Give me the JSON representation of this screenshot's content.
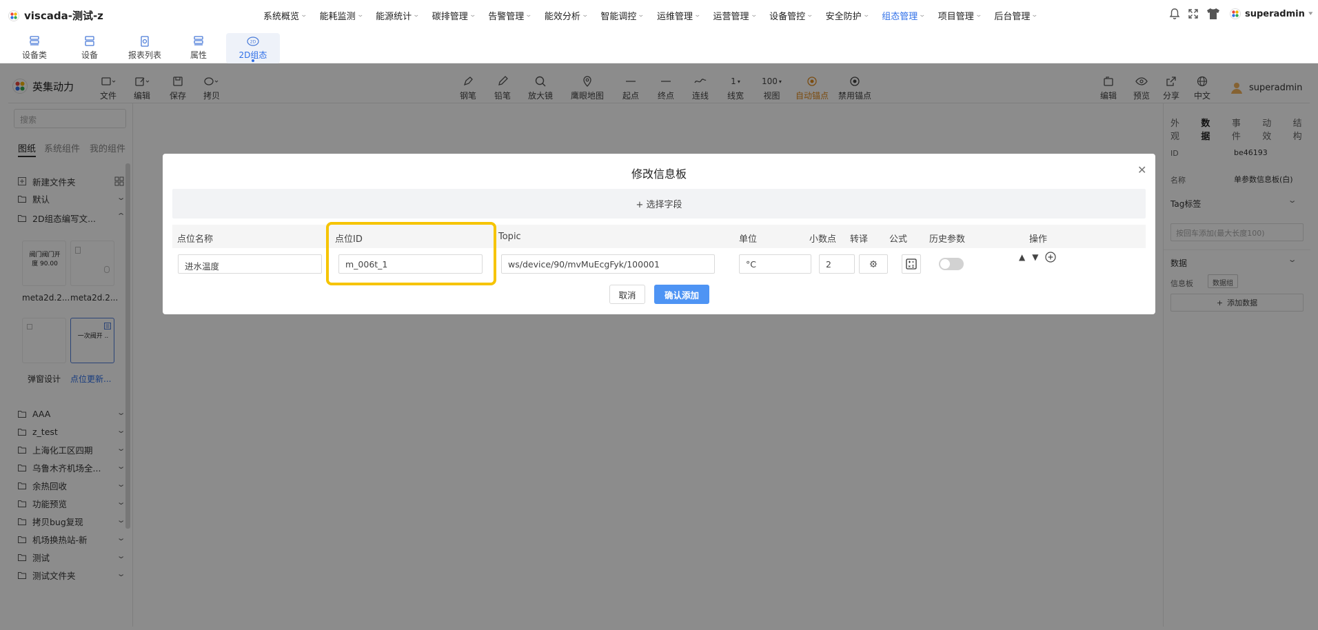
{
  "app": {
    "title": "viscada-测试-z",
    "user": "superadmin"
  },
  "mainnav": [
    {
      "label": "系统概览"
    },
    {
      "label": "能耗监测"
    },
    {
      "label": "能源统计"
    },
    {
      "label": "碳排管理"
    },
    {
      "label": "告警管理"
    },
    {
      "label": "能效分析"
    },
    {
      "label": "智能调控"
    },
    {
      "label": "运维管理"
    },
    {
      "label": "运营管理"
    },
    {
      "label": "设备管控"
    },
    {
      "label": "安全防护"
    },
    {
      "label": "组态管理",
      "active": true
    },
    {
      "label": "项目管理"
    },
    {
      "label": "后台管理"
    }
  ],
  "subtabs": [
    "设备类",
    "设备",
    "报表列表",
    "属性",
    "2D组态"
  ],
  "editor": {
    "logo": "英集动力",
    "tools_left": [
      "文件",
      "编辑",
      "保存",
      "拷贝"
    ],
    "tools_center": [
      "钢笔",
      "铅笔",
      "放大镜",
      "鹰眼地图",
      "起点",
      "终点",
      "连线",
      "线宽",
      "视图",
      "自动锚点",
      "禁用锚点"
    ],
    "line_width_value": "1",
    "view_value": "100",
    "tools_right": [
      "编辑",
      "预览",
      "分享",
      "中文"
    ],
    "user": "superadmin"
  },
  "leftpanel": {
    "search_placeholder": "搜索",
    "tabs": [
      "图纸",
      "系统组件",
      "我的组件"
    ],
    "new_folder": "新建文件夹",
    "folders_top": [
      "默认",
      "2D组态编写文..."
    ],
    "thumbs": [
      {
        "name": "meta2d.2...",
        "preview": "阀门阀门开度 90.00"
      },
      {
        "name": "meta2d.2...",
        "preview": ""
      },
      {
        "name": "弹窗设计",
        "preview": ""
      },
      {
        "name": "点位更新...",
        "preview": "一次阀开 .."
      }
    ],
    "folders_bottom": [
      "AAA",
      "z_test",
      "上海化工区四期",
      "乌鲁木齐机场全...",
      "余热回收",
      "功能预览",
      "拷贝bug复现",
      "机场换热站-新",
      "测试",
      "测试文件夹"
    ]
  },
  "rightpanel": {
    "tabs": [
      "外观",
      "数据",
      "事件",
      "动效",
      "结构"
    ],
    "id_label": "ID",
    "id_value": "be46193",
    "name_label": "名称",
    "name_value": "单参数信息板(白)",
    "tag_label": "Tag标签",
    "tag_placeholder": "按回车添加(最大长度100)",
    "data_label": "数据",
    "infoboard_label": "信息板",
    "datagroup_label": "数据组",
    "add_data": "添加数据"
  },
  "modal": {
    "title": "修改信息板",
    "select_field": "+ 选择字段",
    "headers": {
      "name": "点位名称",
      "id": "点位ID",
      "topic": "Topic",
      "unit": "单位",
      "decimals": "小数点",
      "translate": "转译",
      "formula": "公式",
      "history": "历史参数",
      "ops": "操作"
    },
    "row": {
      "name": "进水温度",
      "id": "m_006t_1",
      "topic": "ws/device/90/mvMuEcgFyk/100001",
      "unit": "°C",
      "decimals": "2"
    },
    "history_enabled": false,
    "cancel": "取消",
    "confirm": "确认添加"
  },
  "colors": {
    "accent": "#2f6fe8",
    "primary_button": "#4e94f4",
    "highlight": "#f6c400",
    "auto_anchor": "#e08a1e"
  }
}
